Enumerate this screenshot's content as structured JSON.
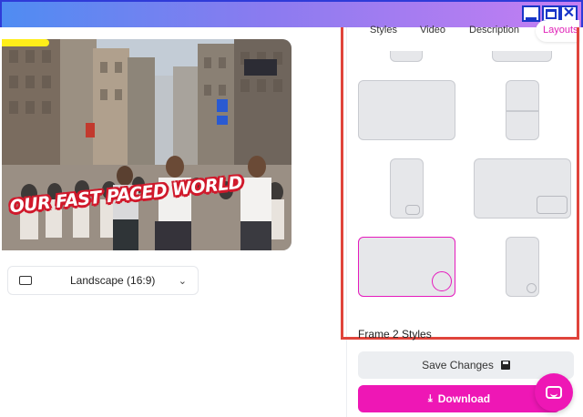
{
  "window": {
    "controls": [
      "minimize-icon",
      "maximize-icon",
      "close-icon"
    ]
  },
  "preview": {
    "caption": "OUR FAST PACED WORLD",
    "aspect": {
      "label": "Landscape (16:9)",
      "icon": "landscape-rect-icon"
    }
  },
  "panel": {
    "tabs": [
      {
        "label": "Styles"
      },
      {
        "label": "Video"
      },
      {
        "label": "Description"
      },
      {
        "label": "Layouts",
        "active": true
      }
    ],
    "section_title": "Frame 2 Styles",
    "save_label": "Save Changes",
    "download_label": "Download"
  },
  "colors": {
    "accent": "#ee17b5",
    "highlight_frame": "#e0443b",
    "window_border": "#2f3bd8"
  }
}
